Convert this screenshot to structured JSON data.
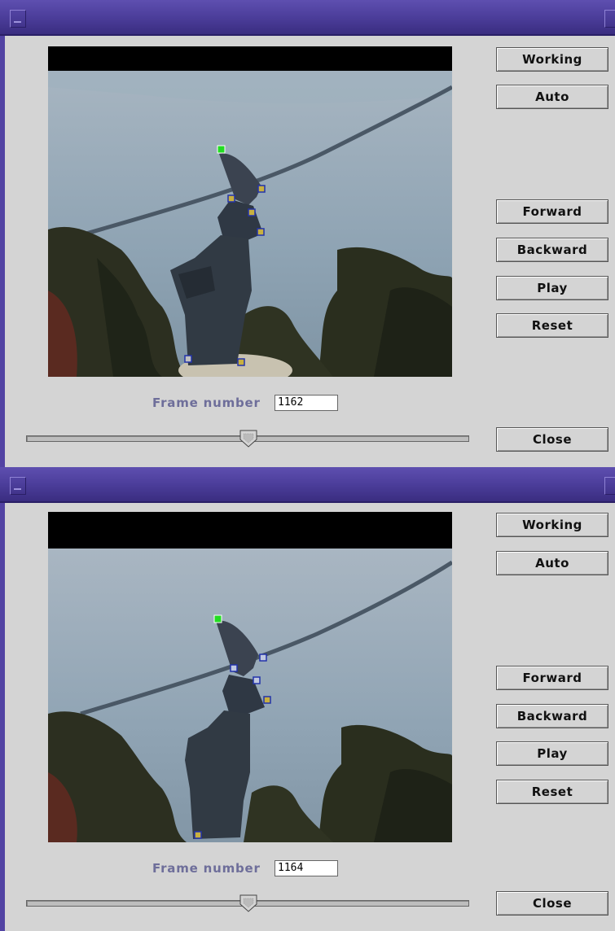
{
  "windows": [
    {
      "frame_label": "Frame number",
      "frame_value": "1162",
      "buttons": {
        "working": "Working",
        "auto": "Auto",
        "forward": "Forward",
        "backward": "Backward",
        "play": "Play",
        "reset": "Reset",
        "close": "Close"
      },
      "slider_value_fraction": 0.5
    },
    {
      "frame_label": "Frame number",
      "frame_value": "1164",
      "buttons": {
        "working": "Working",
        "auto": "Auto",
        "forward": "Forward",
        "backward": "Backward",
        "play": "Play",
        "reset": "Reset",
        "close": "Close"
      },
      "slider_value_fraction": 0.5
    }
  ],
  "colors": {
    "titlebar": "#4a3c98",
    "window_bg": "#d4d4d4",
    "label_text": "#6e6e9a",
    "root_marker": "#22dd22",
    "joint_marker": "#c8b040"
  }
}
